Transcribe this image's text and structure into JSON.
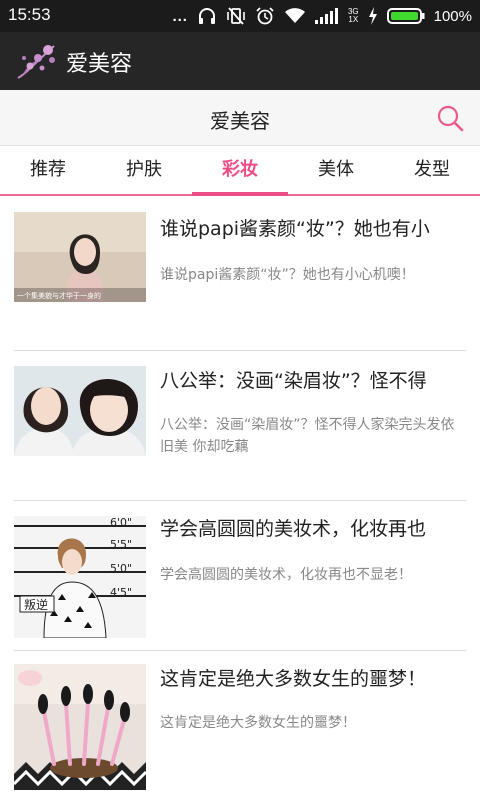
{
  "status": {
    "time": "15:53",
    "dots": "...",
    "net_top": "3G",
    "net_bottom": "1X",
    "battery": "100%"
  },
  "app": {
    "title": "爱美容"
  },
  "header": {
    "title": "爱美容"
  },
  "tabs": [
    {
      "label": "推荐"
    },
    {
      "label": "护肤"
    },
    {
      "label": "彩妆"
    },
    {
      "label": "美体"
    },
    {
      "label": "发型"
    }
  ],
  "active_tab": "彩妆",
  "articles": [
    {
      "title": "谁说papi酱素颜“妆”？她也有小",
      "summary": "谁说papi酱素颜“妆”？她也有小心机噢！",
      "thumb_caption": "一个集美貌与才华于一身的"
    },
    {
      "title": "八公举：没画“染眉妆”？怪不得",
      "summary": "八公举：没画“染眉妆”？怪不得人家染完头发依旧美 你却吃藕"
    },
    {
      "title": "学会高圆圆的美妆术，化妆再也",
      "summary": "学会高圆圆的美妆术，化妆再也不显老！",
      "thumb_heights": [
        "6'0\"",
        "5'5\"",
        "5'0\"",
        "4'5\""
      ],
      "thumb_sign": "叛逆"
    },
    {
      "title": "这肯定是绝大多数女生的噩梦！",
      "summary": "这肯定是绝大多数女生的噩梦！"
    }
  ]
}
